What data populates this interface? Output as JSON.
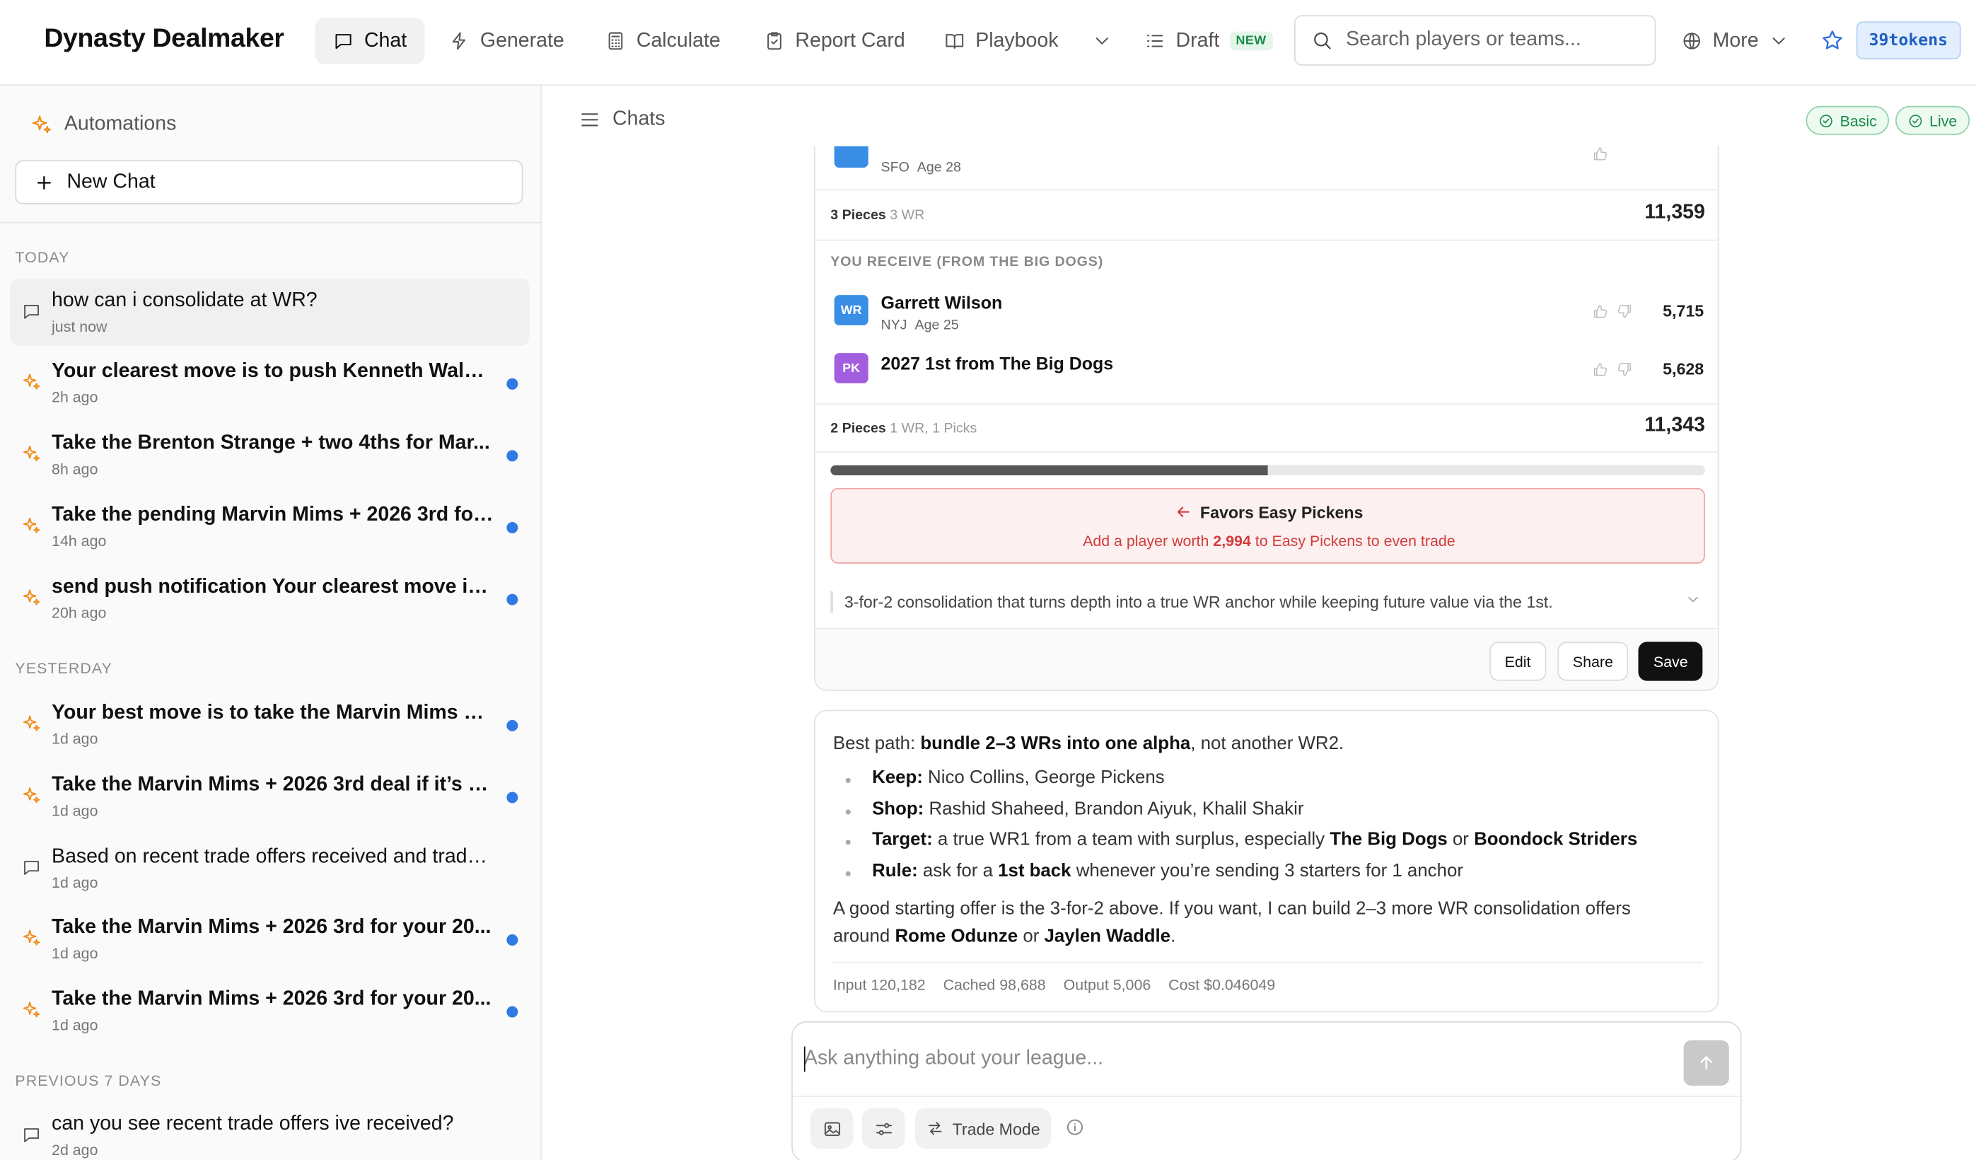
{
  "app": {
    "brand": "Dynasty Dealmaker",
    "nav": {
      "chat": "Chat",
      "generate": "Generate",
      "calculate": "Calculate",
      "report_card": "Report Card",
      "playbook": "Playbook",
      "draft": "Draft",
      "draft_badge": "NEW",
      "more": "More"
    },
    "search_placeholder": "Search players or teams...",
    "tokens": "39tokens",
    "accent_color": "#2f6fdb"
  },
  "sidebar": {
    "automations": "Automations",
    "new_chat": "New Chat",
    "sections": {
      "today": "TODAY",
      "yesterday": "YESTERDAY",
      "previous7": "PREVIOUS 7 DAYS"
    },
    "items": [
      {
        "icon": "chat-bubble-icon",
        "title": "how can i consolidate at WR?",
        "time": "just now",
        "unread": false,
        "selected": true
      },
      {
        "icon": "sparkle-icon",
        "title": "Your clearest move is to push Kenneth Walke...",
        "time": "2h ago",
        "unread": true
      },
      {
        "icon": "sparkle-icon",
        "title": "Take the Brenton Strange + two 4ths for Mar...",
        "time": "8h ago",
        "unread": true
      },
      {
        "icon": "sparkle-icon",
        "title": "Take the pending Marvin Mims + 2026 3rd for...",
        "time": "14h ago",
        "unread": true
      },
      {
        "icon": "sparkle-icon",
        "title": "send push notification Your clearest move is ...",
        "time": "20h ago",
        "unread": true
      },
      {
        "icon": "sparkle-icon",
        "title": "Your best move is to take the Marvin Mims + ...",
        "time": "1d ago",
        "unread": true
      },
      {
        "icon": "sparkle-icon",
        "title": "Take the Marvin Mims + 2026 3rd deal if it’s s...",
        "time": "1d ago",
        "unread": true
      },
      {
        "icon": "chat-bubble-icon",
        "title": "Based on recent trade offers received and trade bl...",
        "time": "1d ago",
        "unread": false
      },
      {
        "icon": "sparkle-icon",
        "title": "Take the Marvin Mims + 2026 3rd for your 20...",
        "time": "1d ago",
        "unread": true
      },
      {
        "icon": "sparkle-icon",
        "title": "Take the Marvin Mims + 2026 3rd for your 20...",
        "time": "1d ago",
        "unread": true
      },
      {
        "icon": "chat-bubble-icon",
        "title": "can you see recent trade offers ive received?",
        "time": "2d ago",
        "unread": false
      }
    ]
  },
  "main": {
    "header": "Chats",
    "modes": {
      "basic": "Basic",
      "live": "Live"
    },
    "trade_card": {
      "send_partial": {
        "team": "SFO",
        "age": "Age 28"
      },
      "send_summary": {
        "pieces": "3 Pieces",
        "detail": "3 WR",
        "total": "11,359"
      },
      "receive_label": "YOU RECEIVE (FROM THE BIG DOGS)",
      "receive": [
        {
          "badge": "WR",
          "badge_color": "#3a8ee6",
          "name": "Garrett Wilson",
          "team": "NYJ",
          "age": "Age 25",
          "value": "5,715"
        },
        {
          "badge": "PK",
          "badge_color": "#a35ee0",
          "name": "2027 1st from The Big Dogs",
          "team": "",
          "age": "",
          "value": "5,628"
        }
      ],
      "receive_summary": {
        "pieces": "2 Pieces",
        "detail": "1 WR, 1 Picks",
        "total": "11,343"
      },
      "balance_fraction": 0.5,
      "favors_title": "Favors Easy Pickens",
      "favors_pre": "Add a player worth ",
      "favors_amount": "2,994",
      "favors_post": " to Easy Pickens to even trade",
      "summary": "3-for-2 consolidation that turns depth into a true WR anchor while keeping future value via the 1st.",
      "buttons": {
        "edit": "Edit",
        "share": "Share",
        "save": "Save"
      }
    },
    "answer": {
      "intro_pre": "Best path: ",
      "intro_bold": "bundle 2–3 WRs into one alpha",
      "intro_post": ", not another WR2.",
      "bullets": {
        "keep_label": "Keep:",
        "keep_text": " Nico Collins, George Pickens",
        "shop_label": "Shop:",
        "shop_text": " Rashid Shaheed, Brandon Aiyuk, Khalil Shakir",
        "target_label": "Target:",
        "target_text1": " a true WR1 from a team with surplus, especially ",
        "target_team1": "The Big Dogs",
        "target_or": " or ",
        "target_team2": "Boondock Striders",
        "rule_label": "Rule:",
        "rule_text1": " ask for a ",
        "rule_bold": "1st back",
        "rule_text2": " whenever you’re sending 3 starters for 1 anchor"
      },
      "outro_pre": "A good starting offer is the 3-for-2 above. If you want, I can build 2–3 more WR consolidation offers around ",
      "outro_p1": "Rome Odunze",
      "outro_or": " or ",
      "outro_p2": "Jaylen Waddle",
      "outro_end": ".",
      "usage": {
        "input": "Input 120,182",
        "cached": "Cached 98,688",
        "output": "Output 5,006",
        "cost": "Cost $0.046049"
      }
    },
    "composer": {
      "placeholder": "Ask anything about your league...",
      "trade_mode": "Trade Mode"
    }
  }
}
